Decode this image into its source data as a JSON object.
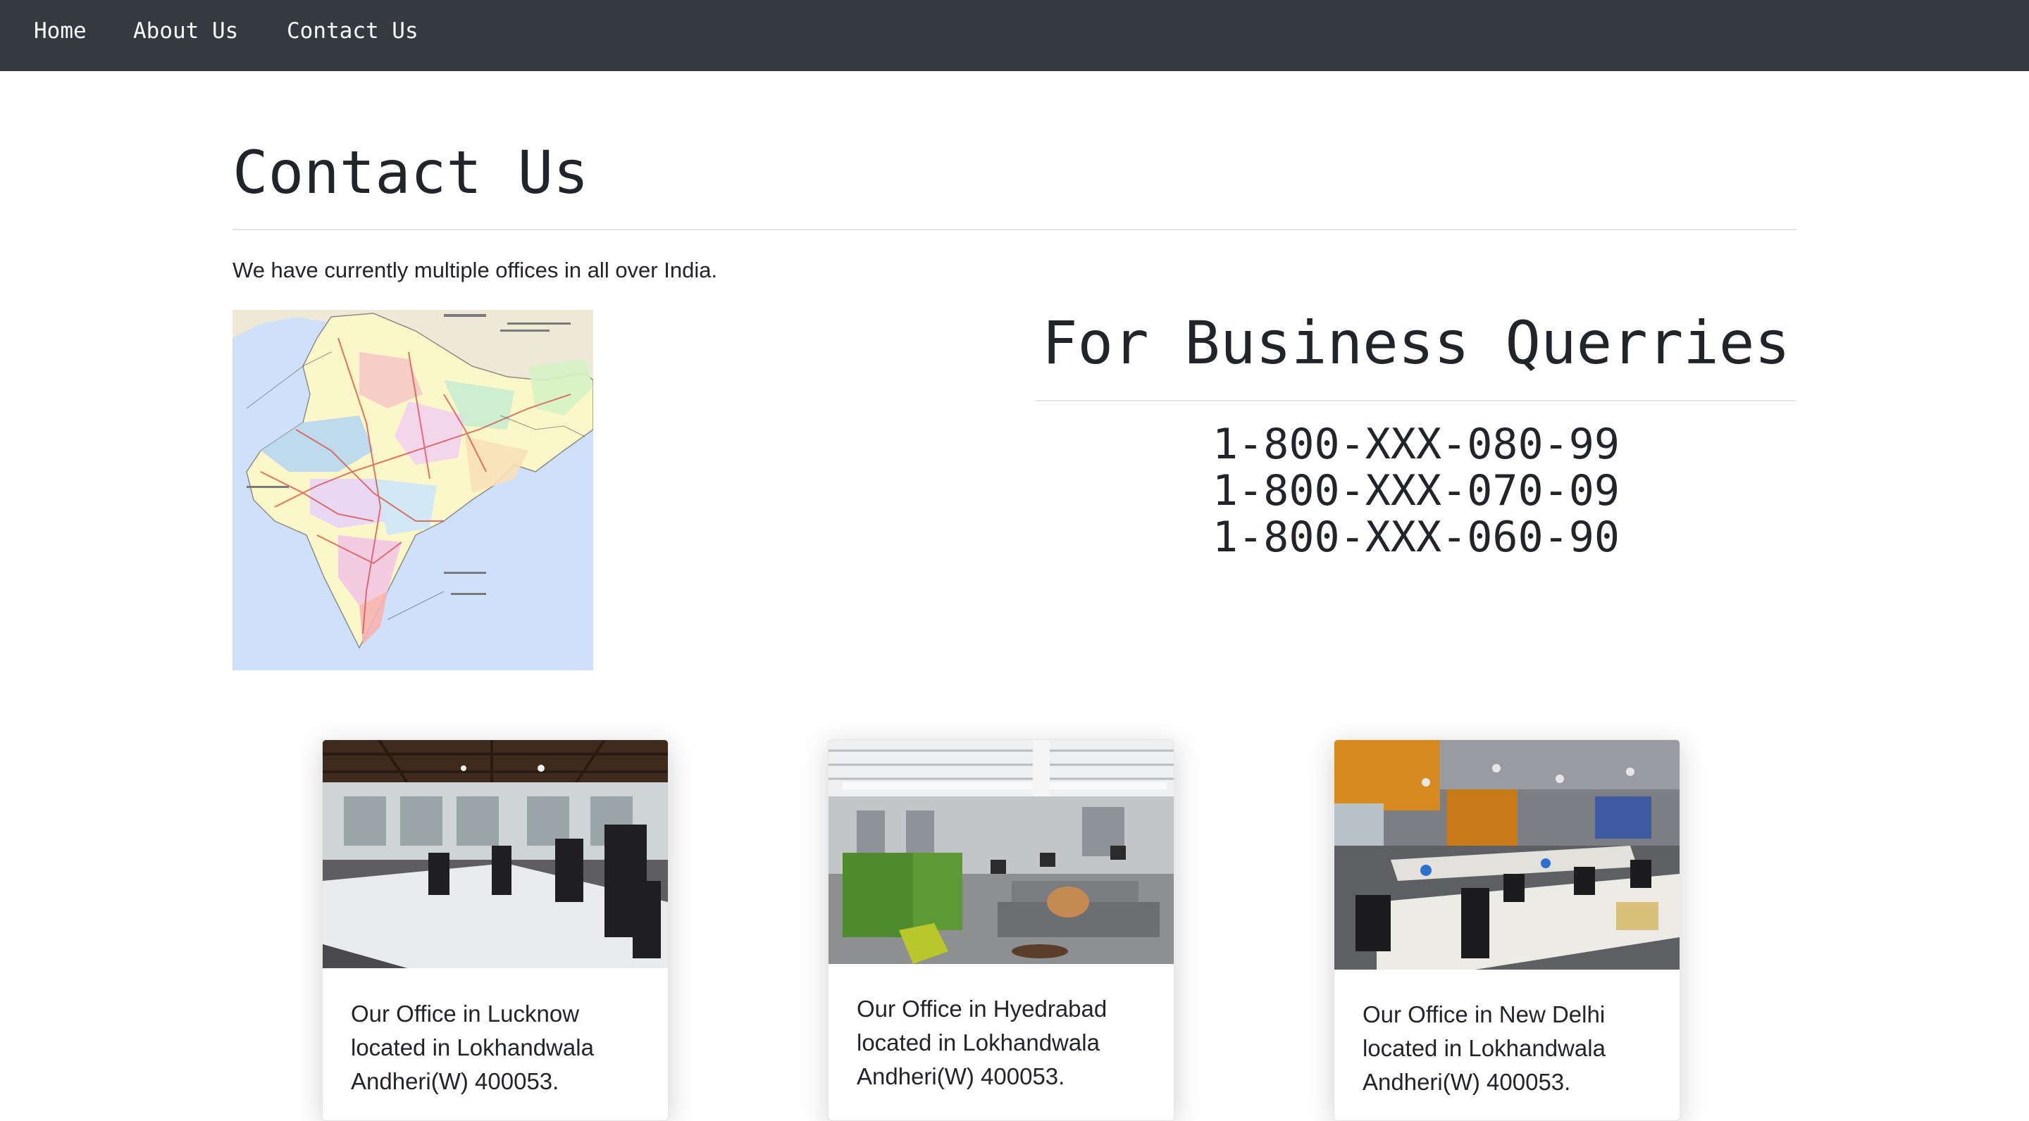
{
  "nav": {
    "items": [
      {
        "label": "Home"
      },
      {
        "label": "About Us"
      },
      {
        "label": "Contact Us"
      }
    ]
  },
  "page": {
    "title": "Contact Us",
    "intro": "We have currently multiple offices in all over India."
  },
  "business": {
    "title": "For Business Querries",
    "phones": [
      "1-800-XXX-080-99",
      "1-800-XXX-070-09",
      "1-800-XXX-060-90"
    ]
  },
  "offices": [
    {
      "text": "Our Office in Lucknow located in Lokhandwala Andheri(W) 400053."
    },
    {
      "text": "Our Office in Hyedrabad located in Lokhandwala Andheri(W) 400053."
    },
    {
      "text": "Our Office in New Delhi located in Lokhandwala Andheri(W) 400053."
    }
  ],
  "colors": {
    "navbar": "#343a40",
    "text": "#212529",
    "nav_text": "#ffffff",
    "map_water": "#cfe0fb"
  }
}
